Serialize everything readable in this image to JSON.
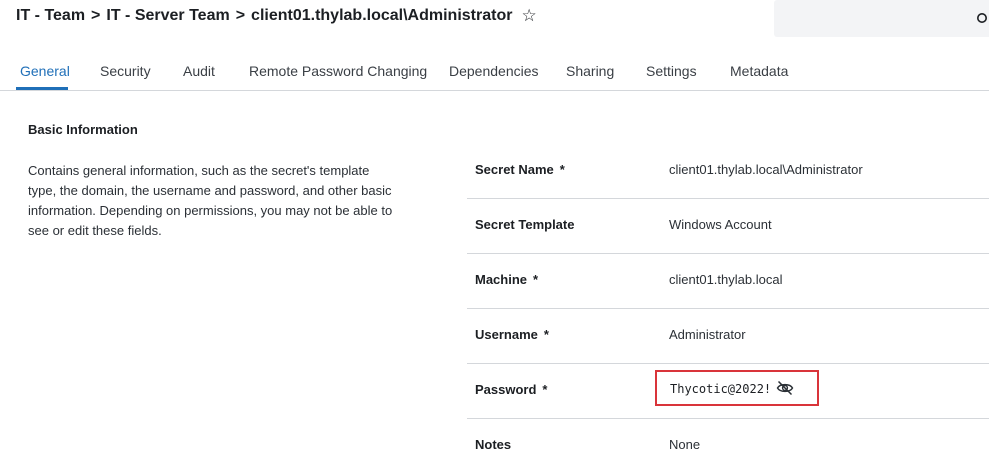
{
  "breadcrumb": {
    "items": [
      "IT - Team",
      "IT - Server Team",
      "client01.thylab.local\\Administrator"
    ],
    "separator": ">",
    "favorite_glyph": "☆"
  },
  "search": {
    "placeholder": "",
    "icon": "search-icon"
  },
  "tabs": [
    {
      "label": "General",
      "active": true
    },
    {
      "label": "Security",
      "active": false
    },
    {
      "label": "Audit",
      "active": false
    },
    {
      "label": "Remote Password Changing",
      "active": false
    },
    {
      "label": "Dependencies",
      "active": false
    },
    {
      "label": "Sharing",
      "active": false
    },
    {
      "label": "Settings",
      "active": false
    },
    {
      "label": "Metadata",
      "active": false
    }
  ],
  "section": {
    "title": "Basic Information",
    "description": "Contains general information, such as the secret's template type, the domain, the username and password, and other basic information. Depending on permissions, you may not be able to see or edit these fields."
  },
  "fields": [
    {
      "label": "Secret Name",
      "required": "*",
      "value": "client01.thylab.local\\Administrator"
    },
    {
      "label": "Secret Template",
      "required": "",
      "value": "Windows Account"
    },
    {
      "label": "Machine",
      "required": "*",
      "value": "client01.thylab.local"
    },
    {
      "label": "Username",
      "required": "*",
      "value": "Administrator"
    },
    {
      "label": "Password",
      "required": "*",
      "value": "Thycotic@2022!",
      "icon": "eye-slash-icon"
    },
    {
      "label": "Notes",
      "required": "",
      "value": "None"
    }
  ],
  "colors": {
    "accent": "#1f6fb8",
    "highlight_border": "#d9343a"
  }
}
